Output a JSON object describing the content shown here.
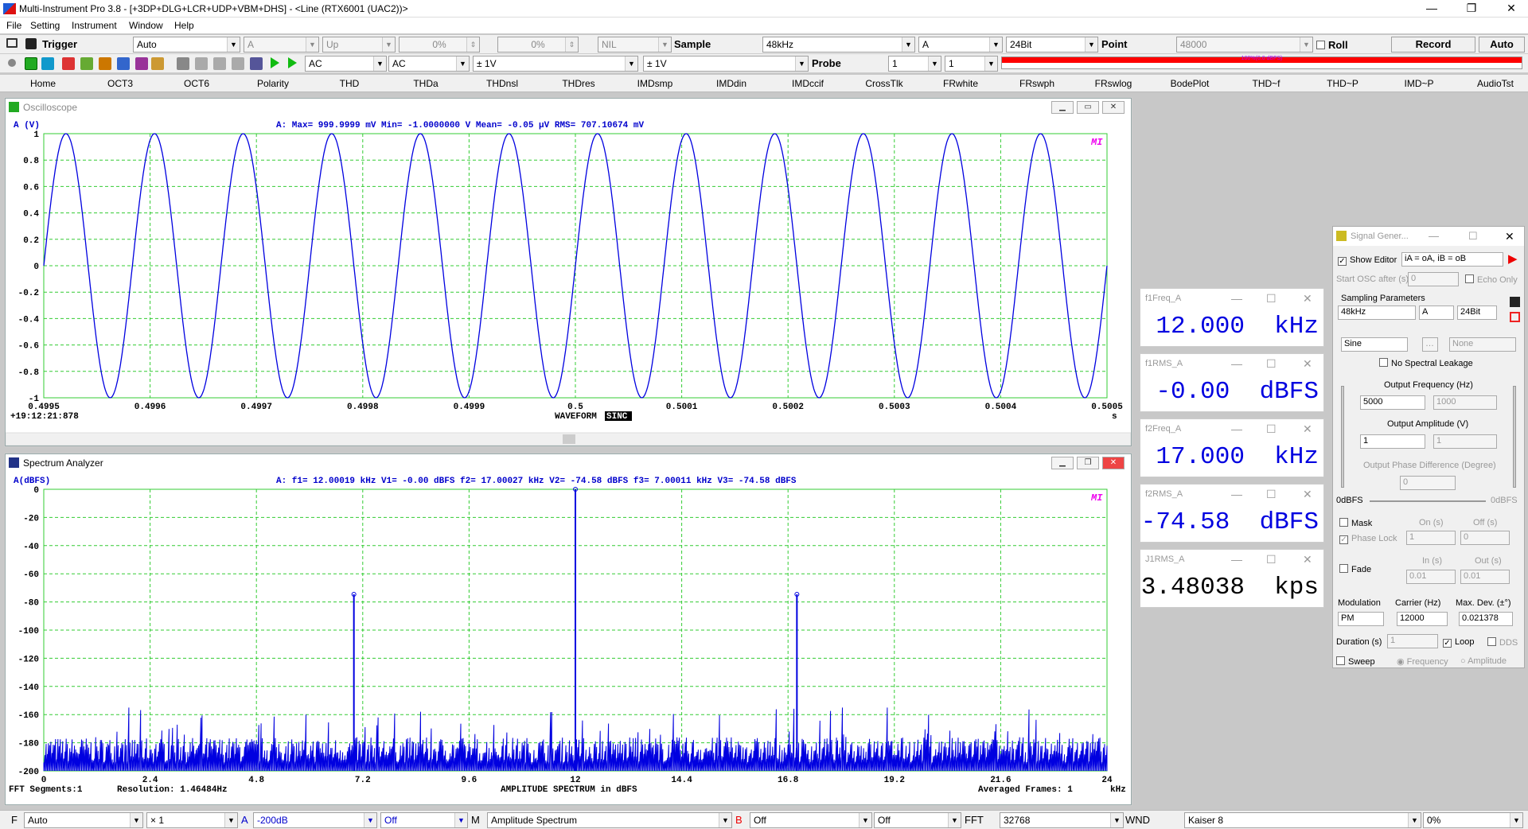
{
  "titlebar": {
    "title": "Multi-Instrument Pro 3.8  -  [+3DP+DLG+LCR+UDP+VBM+DHS]  -  <Line (RTX6001 (UAC2))>",
    "minimize": "—",
    "restore": "❐",
    "close": "✕"
  },
  "menu": [
    "File",
    "Setting",
    "Instrument",
    "Window",
    "Help"
  ],
  "toolbar1": {
    "trigger_label": "Trigger",
    "trigger_mode": "Auto",
    "channel": "A",
    "edge": "Up",
    "level": "0%",
    "delay": "0%",
    "nil": "NIL",
    "sample_label": "Sample",
    "sample_rate": "48kHz",
    "sample_channel": "A",
    "bits": "24Bit",
    "point_label": "Point",
    "points": "48000",
    "roll_label": "Roll",
    "record_label": "Record",
    "auto_label": "Auto"
  },
  "toolbar2": {
    "coupling_a": "AC",
    "coupling_b": "AC",
    "range_a": "± 1V",
    "range_b": "± 1V",
    "probe_label": "Probe",
    "probe_a": "1",
    "probe_b": "1",
    "progress_text": "100%(0.0 dBFS)",
    "progress_color": "#ff0000"
  },
  "tabs": [
    "Home",
    "OCT3",
    "OCT6",
    "Polarity",
    "THD",
    "THDa",
    "THDnsl",
    "THDres",
    "IMDsmp",
    "IMDdin",
    "IMDccif",
    "CrossTlk",
    "FRwhite",
    "FRswph",
    "FRswlog",
    "BodePlot",
    "THD~f",
    "THD~P",
    "IMD~P",
    "AudioTst"
  ],
  "oscilloscope": {
    "title": "Oscilloscope",
    "axis_label": "A (V)",
    "stats": "A: Max=    999.9999 mV  Min= -1.0000000  V  Mean=       -0.05 µV  RMS=    707.10674 mV",
    "timestamp": "+19:12:21:878",
    "footer": "WAVEFORM",
    "footer_mode": "SINC",
    "x_unit": "s",
    "mi_logo": "MI"
  },
  "spectrum": {
    "title": "Spectrum Analyzer",
    "axis_label": "A(dBFS)",
    "stats": "A: f1= 12.00019 kHz V1=  -0.00 dBFS  f2= 17.00027 kHz V2= -74.58 dBFS  f3=  7.00011 kHz V3= -74.58 dBFS",
    "fft_segments": "FFT Segments:1",
    "resolution": "Resolution: 1.46484Hz",
    "footer": "AMPLITUDE SPECTRUM in dBFS",
    "averaged": "Averaged Frames: 1",
    "x_unit": "kHz",
    "mi_logo": "MI"
  },
  "chart_data": [
    {
      "type": "line",
      "title": "",
      "xlabel": "s",
      "ylabel": "A (V)",
      "xlim": [
        0.4995,
        0.5005
      ],
      "ylim": [
        -1,
        1
      ],
      "x_ticks": [
        "0.4995",
        "0.4996",
        "0.4997",
        "0.4998",
        "0.4999",
        "0.5",
        "0.5001",
        "0.5002",
        "0.5003",
        "0.5004",
        "0.5005"
      ],
      "y_ticks": [
        "1",
        "0.8",
        "0.6",
        "0.4",
        "0.2",
        "0",
        "-0.2",
        "-0.4",
        "-0.6",
        "-0.8",
        "-1"
      ],
      "grid": true,
      "series": [
        {
          "name": "A",
          "color": "#0000e0",
          "frequency_hz": 12000,
          "amplitude": 1.0
        }
      ]
    },
    {
      "type": "line",
      "title": "",
      "xlabel": "kHz",
      "ylabel": "A(dBFS)",
      "xlim": [
        0,
        24
      ],
      "ylim": [
        -200,
        0
      ],
      "x_ticks": [
        "0",
        "2.4",
        "4.8",
        "7.2",
        "9.6",
        "12",
        "14.4",
        "16.8",
        "19.2",
        "21.6",
        "24"
      ],
      "y_ticks": [
        "0",
        "-20",
        "-40",
        "-60",
        "-80",
        "-100",
        "-120",
        "-140",
        "-160",
        "-180",
        "-200"
      ],
      "grid": true,
      "peaks": [
        {
          "x": 7.00011,
          "y": -74.58
        },
        {
          "x": 12.00019,
          "y": 0.0
        },
        {
          "x": 17.00027,
          "y": -74.58
        }
      ],
      "noise_floor_db": -185,
      "series": [
        {
          "name": "A",
          "color": "#0000e0"
        }
      ]
    }
  ],
  "meters": [
    {
      "title": "f1Freq_A",
      "value": "12.000  kHz",
      "color": "#0000e0"
    },
    {
      "title": "f1RMS_A",
      "value": "-0.00  dBFS",
      "color": "#0000e0"
    },
    {
      "title": "f2Freq_A",
      "value": "17.000  kHz",
      "color": "#0000e0"
    },
    {
      "title": "f2RMS_A",
      "value": "-74.58  dBFS",
      "color": "#0000e0"
    },
    {
      "title": "J1RMS_A",
      "value": "3.48038  kps",
      "color": "#000000"
    }
  ],
  "signal_generator": {
    "title": "Signal Gener...",
    "show_editor": "Show Editor",
    "editor_expr": "iA = oA, iB = oB",
    "start_osc": "Start OSC after (s)",
    "start_osc_value": "0",
    "echo_only": "Echo Only",
    "sampling_params": "Sampling Parameters",
    "rate": "48kHz",
    "channel": "A",
    "bits": "24Bit",
    "waveform_a": "Sine",
    "waveform_b": "None",
    "no_spectral_leakage": "No Spectral Leakage",
    "output_freq_label": "Output Frequency (Hz)",
    "freq_a": "5000",
    "freq_b": "1000",
    "output_amp_label": "Output Amplitude (V)",
    "amp_a": "1",
    "amp_b": "1",
    "phase_diff": "Output Phase Difference (Degree)",
    "phase_value": "0",
    "odbfs_left": "0dBFS",
    "odbfs_right": "0dBFS",
    "mask": "Mask",
    "on_s": "On (s)",
    "off_s": "Off (s)",
    "phase_lock": "Phase Lock",
    "mask_on": "1",
    "mask_off": "0",
    "fade": "Fade",
    "in_s": "In (s)",
    "out_s": "Out (s)",
    "fade_in": "0.01",
    "fade_out": "0.01",
    "modulation_label": "Modulation",
    "carrier_label": "Carrier (Hz)",
    "max_dev_label": "Max. Dev. (±°)",
    "modulation": "PM",
    "carrier": "12000",
    "max_dev": "0.021378",
    "duration_label": "Duration (s)",
    "duration": "1",
    "loop": "Loop",
    "dds": "DDS",
    "sweep": "Sweep",
    "sweep_freq": "Frequency",
    "sweep_amp": "Amplitude"
  },
  "bottombar": {
    "f_label": "F",
    "f_mode": "Auto",
    "mult": "× 1",
    "a_label": "A",
    "a_floor": "-200dB",
    "off1": "Off",
    "m_label": "M",
    "m_mode": "Amplitude Spectrum",
    "b_label": "B",
    "off2": "Off",
    "off3": "Off",
    "fft_label": "FFT",
    "fft_size": "32768",
    "wnd_label": "WND",
    "window": "Kaiser 8",
    "overlap": "0%"
  }
}
